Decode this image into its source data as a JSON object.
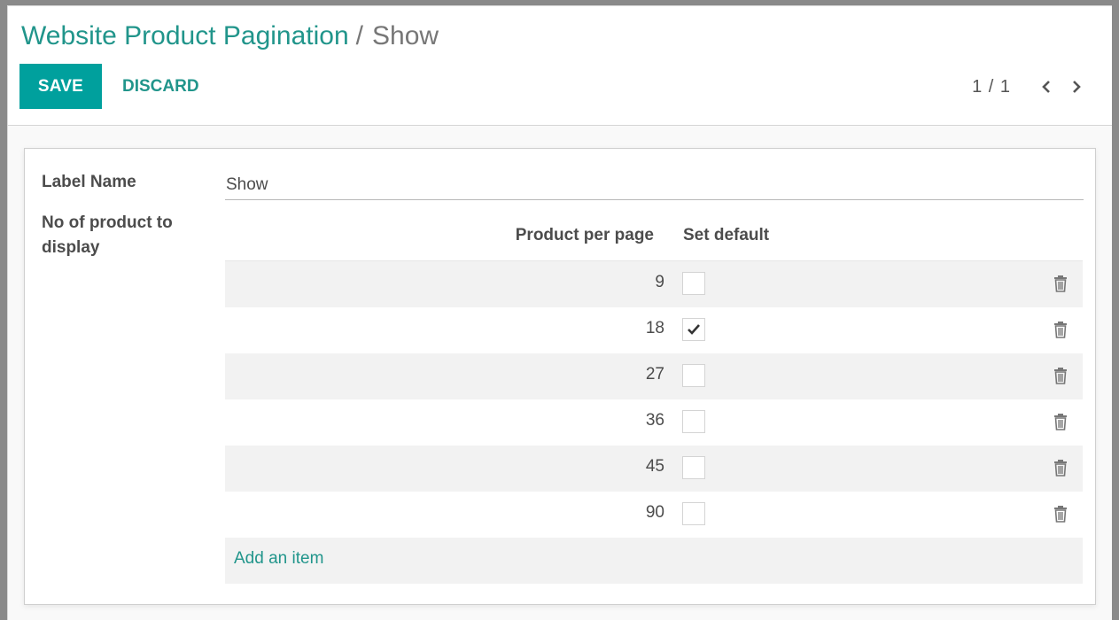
{
  "breadcrumb": {
    "parent": "Website Product Pagination",
    "separator": "/",
    "current": "Show"
  },
  "toolbar": {
    "save_label": "SAVE",
    "discard_label": "DISCARD"
  },
  "pager": {
    "value": "1 / 1",
    "prev_icon": "chevron-left-icon",
    "next_icon": "chevron-right-icon"
  },
  "form": {
    "label_name_label": "Label Name",
    "label_name_value": "Show",
    "products_label_line1": "No of product to",
    "products_label_line2": "display"
  },
  "lines": {
    "headers": {
      "per_page": "Product per page",
      "set_default": "Set default"
    },
    "rows": [
      {
        "per_page": "9",
        "set_default": false
      },
      {
        "per_page": "18",
        "set_default": true
      },
      {
        "per_page": "27",
        "set_default": false
      },
      {
        "per_page": "36",
        "set_default": false
      },
      {
        "per_page": "45",
        "set_default": false
      },
      {
        "per_page": "90",
        "set_default": false
      }
    ],
    "add_item_label": "Add an item",
    "delete_icon": "trash-icon"
  },
  "colors": {
    "accent": "#00a09d",
    "link": "#21958b",
    "text": "#4c4c4c"
  }
}
